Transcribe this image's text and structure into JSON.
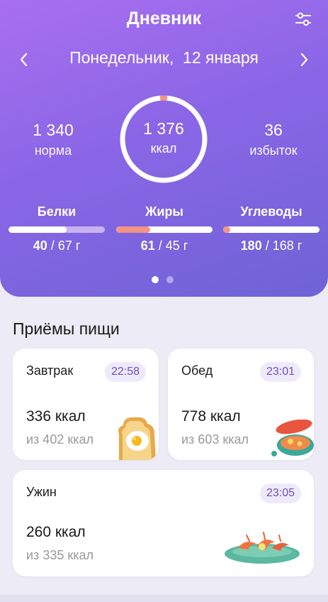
{
  "header": {
    "title": "Дневник",
    "date": "Понедельник,  12 января"
  },
  "summary": {
    "norm_value": "1 340",
    "norm_label": "норма",
    "eaten_value": "1 376",
    "eaten_label": "ккал",
    "excess_value": "36",
    "excess_label": "избыток",
    "ring_excess_fraction": 0.027
  },
  "macros": [
    {
      "name": "Белки",
      "value": "40",
      "target": " / 67 г",
      "fraction": 0.6,
      "fill_color": "#ffffff",
      "track_color": "#c9b2f2"
    },
    {
      "name": "Жиры",
      "value": "61",
      "target": " / 45 г",
      "fraction": 0.35,
      "fill_color": "#f39386",
      "track_color": "#ffffff"
    },
    {
      "name": "Углеводы",
      "value": "180",
      "target": " / 168 г",
      "fraction": 0.07,
      "fill_color": "#f39386",
      "track_color": "#ffffff"
    }
  ],
  "pager": {
    "count": 2,
    "active": 0
  },
  "meals_title": "Приёмы пищи",
  "meals": [
    {
      "name": "Завтрак",
      "time": "22:58",
      "kcal": "336 ккал",
      "of": "из 402 ккал"
    },
    {
      "name": "Обед",
      "time": "23:01",
      "kcal": "778 ккал",
      "of": "из 603 ккал"
    },
    {
      "name": "Ужин",
      "time": "23:05",
      "kcal": "260 ккал",
      "of": "из 335 ккал"
    }
  ],
  "colors": {
    "accent": "#7b65e0",
    "ring_excess": "#f39386",
    "time_text": "#6b4fc3"
  }
}
